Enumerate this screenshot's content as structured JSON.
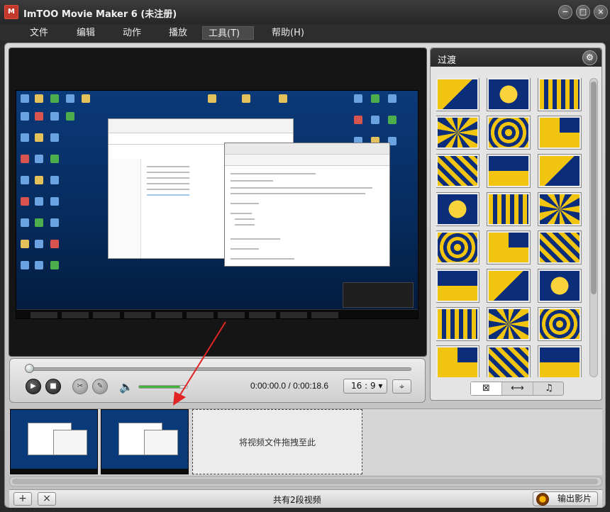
{
  "window": {
    "title": "ImTOO Movie Maker 6 (未注册)",
    "logo_text": "M",
    "controls": {
      "minimize": "−",
      "maximize": "□",
      "close": "×"
    }
  },
  "menu": {
    "items": [
      "文件",
      "编辑",
      "动作",
      "播放",
      "工具(T)",
      "帮助(H)"
    ],
    "active_index": 4
  },
  "preview": {
    "current_time": "0:00:00.0",
    "total_time": "0:00:18.6",
    "aspect_ratio": "16 : 9",
    "seek_position": 0.0,
    "volume_level": 0.85,
    "icons": {
      "play": "▶",
      "stop": "■",
      "cut": "✂",
      "edit": "✎",
      "volume": "🔈",
      "dropdown": "▾",
      "fit": "⌖"
    }
  },
  "transitions": {
    "title": "过渡",
    "gear": "⚙",
    "tabs": [
      "⊠",
      "⟷",
      "♫"
    ],
    "active_tab": 0
  },
  "timeline": {
    "dropzone_label": "将视频文件拖拽至此",
    "clip_count_label": "共有2段视频"
  },
  "bottom": {
    "add_label": "+",
    "remove_label": "×",
    "export_label": "输出影片"
  },
  "colors": {
    "accent_green": "#44b33a",
    "transition_yellow": "#f1c40f",
    "transition_blue": "#0b2d7a",
    "arrow_red": "#e02424"
  }
}
